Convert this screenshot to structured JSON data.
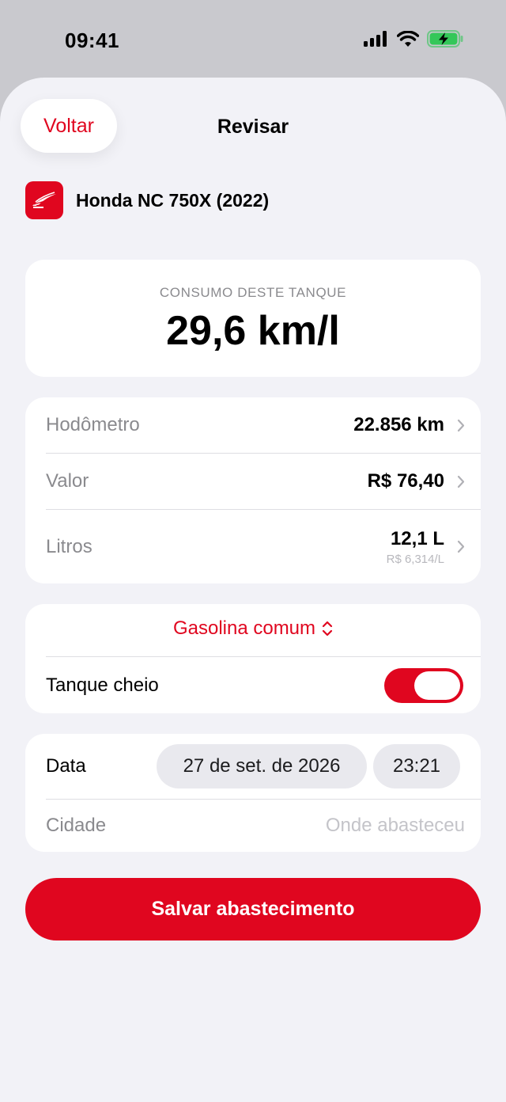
{
  "status_bar": {
    "time": "09:41"
  },
  "nav": {
    "back_label": "Voltar",
    "title": "Revisar"
  },
  "vehicle": {
    "name": "Honda NC 750X (2022)"
  },
  "consumo": {
    "label": "CONSUMO DESTE TANQUE",
    "value": "29,6 km/l"
  },
  "metrics": [
    {
      "label": "Hodômetro",
      "value": "22.856 km"
    },
    {
      "label": "Valor",
      "value": "R$ 76,40"
    },
    {
      "label": "Litros",
      "value": "12,1 L",
      "sub": "R$ 6,314/L"
    }
  ],
  "fuel": {
    "type": "Gasolina comum",
    "tank_full_label": "Tanque cheio",
    "tank_full": true
  },
  "details": {
    "date_label": "Data",
    "date_value": "27 de set. de 2026",
    "time_value": "23:21",
    "city_label": "Cidade",
    "city_placeholder": "Onde abasteceu"
  },
  "save_label": "Salvar abastecimento",
  "colors": {
    "accent": "#e0061f",
    "background": "#f2f2f7",
    "battery": "#34c759"
  }
}
